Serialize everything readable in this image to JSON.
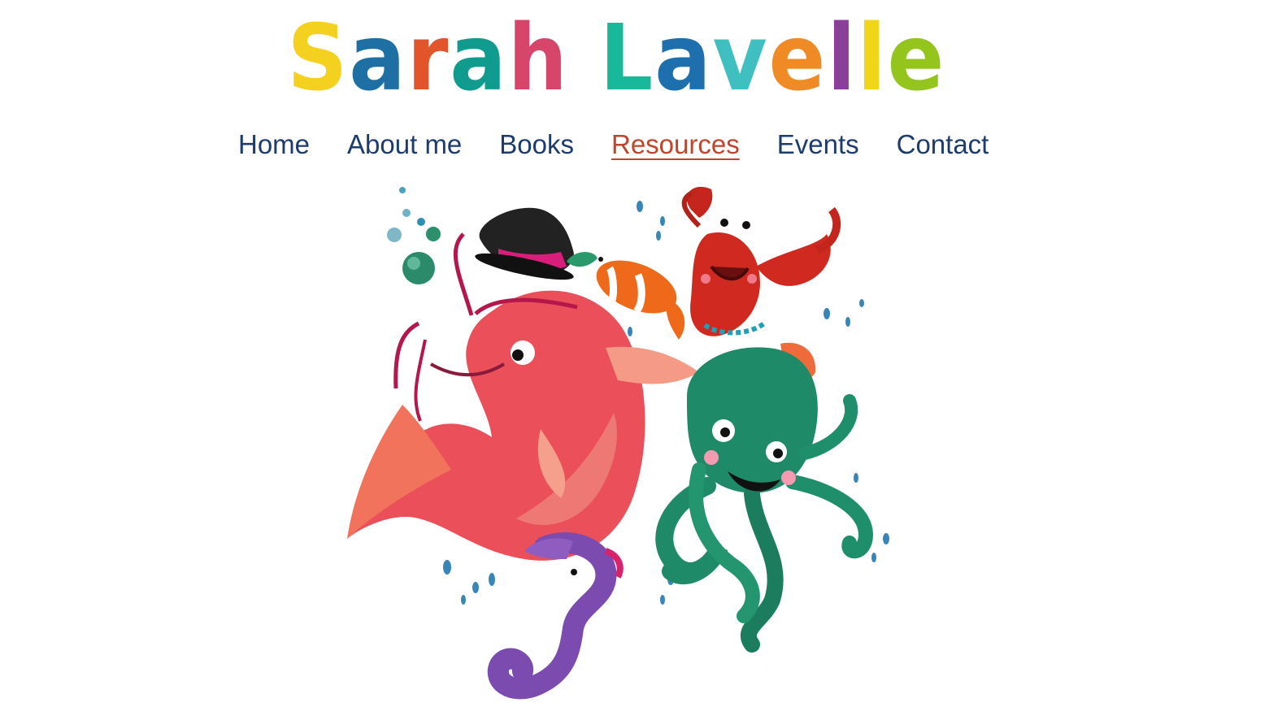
{
  "site": {
    "logo_letters": [
      {
        "char": "S",
        "color": "#f5d11f"
      },
      {
        "char": "a",
        "color": "#1e6fa3"
      },
      {
        "char": "r",
        "color": "#e4542b"
      },
      {
        "char": "a",
        "color": "#0f9b8e"
      },
      {
        "char": "h",
        "color": "#d8456b"
      },
      {
        "char": " ",
        "color": "#ffffff"
      },
      {
        "char": "L",
        "color": "#18b99a"
      },
      {
        "char": "a",
        "color": "#1d6fae"
      },
      {
        "char": "v",
        "color": "#3fbfc0"
      },
      {
        "char": "e",
        "color": "#f08a24"
      },
      {
        "char": "l",
        "color": "#8a3f98"
      },
      {
        "char": "l",
        "color": "#f1d618"
      },
      {
        "char": "e",
        "color": "#94c51c"
      }
    ]
  },
  "nav": {
    "items": [
      {
        "label": "Home",
        "active": false
      },
      {
        "label": "About me",
        "active": false
      },
      {
        "label": "Books",
        "active": false
      },
      {
        "label": "Resources",
        "active": true
      },
      {
        "label": "Events",
        "active": false
      },
      {
        "label": "Contact",
        "active": false
      }
    ],
    "color": "#1d3c6e",
    "active_color": "#c0452c"
  },
  "hero": {
    "illustration": "sea-creatures-illustration"
  }
}
